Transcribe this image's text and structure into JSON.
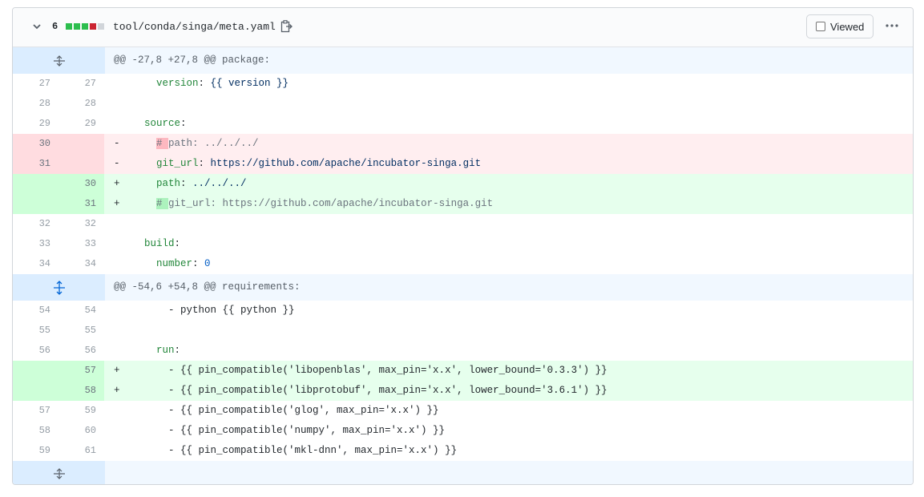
{
  "header": {
    "change_count": "6",
    "diffstat_colors": [
      "#2cbe4e",
      "#2cbe4e",
      "#2cbe4e",
      "#cb2431",
      "#d1d5da"
    ],
    "file_path": "tool/conda/singa/meta.yaml",
    "viewed_label": "Viewed",
    "icons": [
      "chevron-down-icon",
      "copy-icon",
      "kebab-horizontal-icon",
      "unfold-icon"
    ]
  },
  "hunks": [
    {
      "header": "@@ -27,8 +27,8 @@ package:"
    },
    {
      "header": "@@ -54,6 +54,8 @@ requirements:"
    }
  ],
  "lines": [
    {
      "l": "27",
      "r": "27",
      "sign": "",
      "p1": "    ",
      "key": "version",
      "p2": ": ",
      "val": "{{ version }}",
      "valclass": "s"
    },
    {
      "l": "28",
      "r": "28",
      "sign": "",
      "p1": "",
      "key": "",
      "p2": "",
      "val": ""
    },
    {
      "l": "29",
      "r": "29",
      "sign": "",
      "p1": "  ",
      "key": "source",
      "p2": ":",
      "val": ""
    },
    {
      "l": "30",
      "r": "",
      "sign": "-",
      "p1": "    ",
      "hl": "# ",
      "rest": "path: ../../../"
    },
    {
      "l": "31",
      "r": "",
      "sign": "-",
      "p1": "    ",
      "key": "git_url",
      "p2": ": ",
      "val": "https://github.com/apache/incubator-singa.git",
      "valclass": "s"
    },
    {
      "l": "",
      "r": "30",
      "sign": "+",
      "p1": "    ",
      "key": "path",
      "p2": ": ",
      "val": "../../../",
      "valclass": "s"
    },
    {
      "l": "",
      "r": "31",
      "sign": "+",
      "p1": "    ",
      "hl": "# ",
      "rest": "git_url: https://github.com/apache/incubator-singa.git"
    },
    {
      "l": "32",
      "r": "32",
      "sign": "",
      "p1": "",
      "key": "",
      "p2": "",
      "val": ""
    },
    {
      "l": "33",
      "r": "33",
      "sign": "",
      "p1": "  ",
      "key": "build",
      "p2": ":",
      "val": ""
    },
    {
      "l": "34",
      "r": "34",
      "sign": "",
      "p1": "    ",
      "key": "number",
      "p2": ": ",
      "val": "0",
      "valclass": "n"
    },
    {
      "l": "54",
      "r": "54",
      "sign": "",
      "text": "      - python {{ python }}"
    },
    {
      "l": "55",
      "r": "55",
      "sign": "",
      "text": ""
    },
    {
      "l": "56",
      "r": "56",
      "sign": "",
      "p1": "    ",
      "key": "run",
      "p2": ":",
      "val": ""
    },
    {
      "l": "",
      "r": "57",
      "sign": "+",
      "text": "      - {{ pin_compatible('libopenblas', max_pin='x.x', lower_bound='0.3.3') }}"
    },
    {
      "l": "",
      "r": "58",
      "sign": "+",
      "text": "      - {{ pin_compatible('libprotobuf', max_pin='x.x', lower_bound='3.6.1') }}"
    },
    {
      "l": "57",
      "r": "59",
      "sign": "",
      "text": "      - {{ pin_compatible('glog', max_pin='x.x') }}"
    },
    {
      "l": "58",
      "r": "60",
      "sign": "",
      "text": "      - {{ pin_compatible('numpy', max_pin='x.x') }}"
    },
    {
      "l": "59",
      "r": "61",
      "sign": "",
      "text": "      - {{ pin_compatible('mkl-dnn', max_pin='x.x') }}"
    }
  ]
}
